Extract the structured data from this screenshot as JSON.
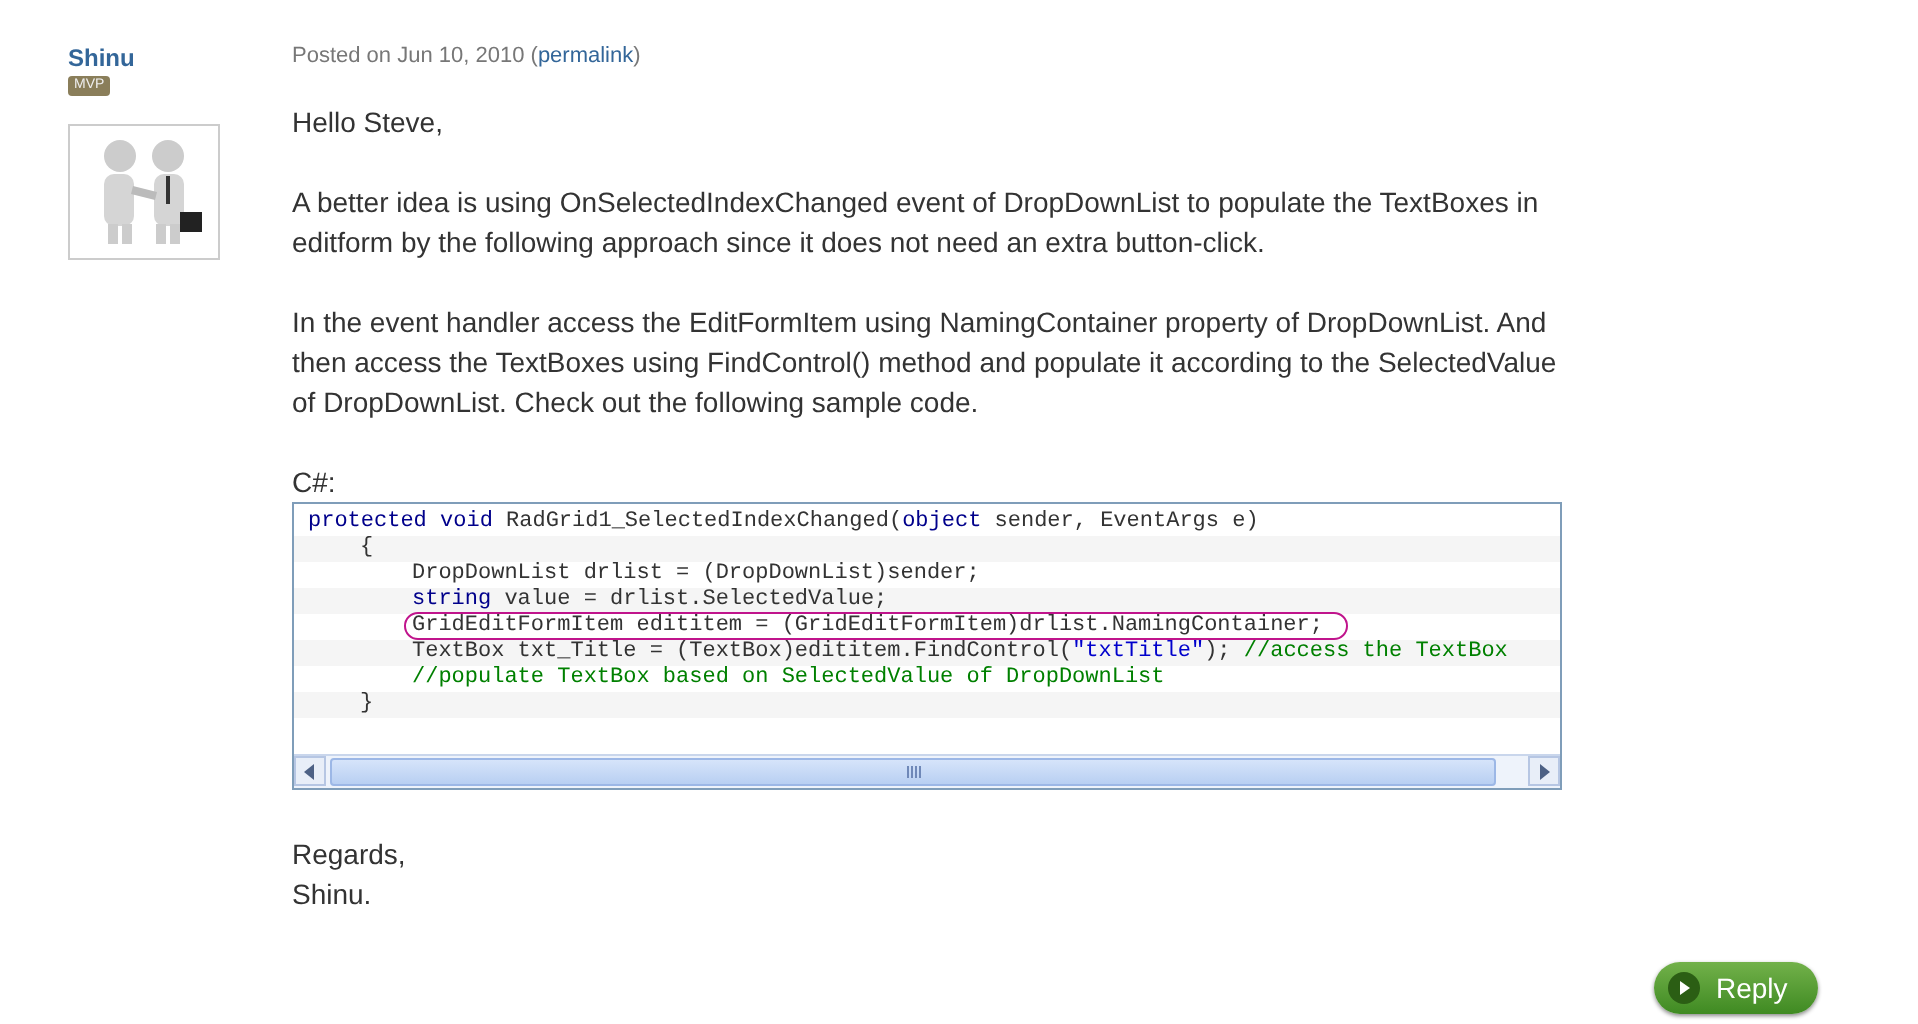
{
  "author": {
    "name": "Shinu",
    "badge": "MVP"
  },
  "post": {
    "posted": "Posted on Jun 10, 2010 (",
    "permalink": "permalink",
    "posted_end": ")",
    "paragraphs": [
      "Hello Steve,",
      "A better idea is using OnSelectedIndexChanged event of DropDownList to populate the TextBoxes in editform by the following approach since it does not need an extra button-click.",
      "In the event handler access the EditFormItem using NamingContainer property of DropDownList. And then access the TextBoxes using FindControl() method and populate it according to the SelectedValue of DropDownList. Check out the following sample code."
    ],
    "code_label": "C#:",
    "code_lines": [
      {
        "circled": false,
        "tokens": [
          {
            "kind": "keyword",
            "text": "protected void"
          },
          {
            "kind": "plain",
            "text": " RadGrid1_SelectedIndexChanged("
          },
          {
            "kind": "keyword",
            "text": "object"
          },
          {
            "kind": "plain",
            "text": " sender, EventArgs e)"
          }
        ],
        "children": [
          {
            "circled": false,
            "tokens": [
              {
                "kind": "plain",
                "text": "{"
              }
            ],
            "children": [
              {
                "circled": false,
                "tokens": [
                  {
                    "kind": "plain",
                    "text": "DropDownList drlist = (DropDownList)sender;"
                  }
                ]
              },
              {
                "circled": false,
                "tokens": [
                  {
                    "kind": "keyword",
                    "text": "string"
                  },
                  {
                    "kind": "plain",
                    "text": " value = drlist.SelectedValue;"
                  }
                ]
              },
              {
                "circled": true,
                "tokens": [
                  {
                    "kind": "plain",
                    "text": "GridEditFormItem edititem = (GridEditFormItem)drlist.NamingContainer;"
                  }
                ]
              },
              {
                "circled": false,
                "tokens": [
                  {
                    "kind": "plain",
                    "text": "TextBox txt_Title = (TextBox)edititem.FindControl("
                  },
                  {
                    "kind": "string",
                    "text": "\"txtTitle\""
                  },
                  {
                    "kind": "plain",
                    "text": "); "
                  },
                  {
                    "kind": "comment",
                    "text": "//access the TextBox"
                  }
                ]
              },
              {
                "circled": false,
                "tokens": [
                  {
                    "kind": "comment",
                    "text": "//populate TextBox based on SelectedValue of DropDownList"
                  }
                ]
              }
            ]
          },
          {
            "circled": false,
            "tokens": [
              {
                "kind": "plain",
                "text": "}"
              }
            ]
          }
        ]
      }
    ],
    "closing": [
      "Regards,",
      "Shinu."
    ]
  },
  "reply_button": {
    "label": "Reply"
  }
}
